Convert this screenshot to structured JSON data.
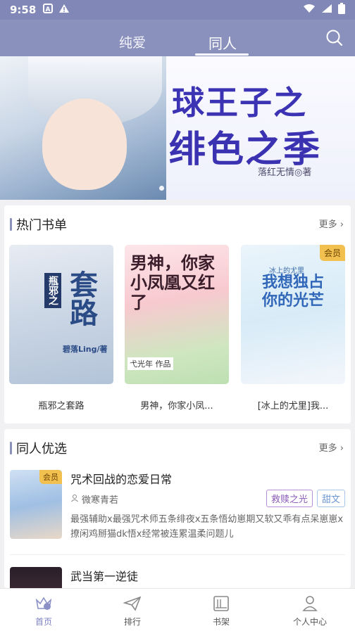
{
  "status": {
    "time": "9:58"
  },
  "header": {
    "tabs": [
      {
        "label": "纯爱"
      },
      {
        "label": "同人"
      }
    ],
    "active_tab": "同人"
  },
  "banner": {
    "title_line1": "球王子之",
    "title_line2": "绯色之季",
    "author": "落红无情◎著"
  },
  "hot": {
    "title": "热门书单",
    "more": "更多",
    "books": [
      {
        "name": "瓶邪之套路",
        "cover_title": "套路",
        "cover_sub": "瓶邪之",
        "cover_author": "碧落Ling/著",
        "badge": ""
      },
      {
        "name": "男神，你家小凤...",
        "cover_title": "男神，你家小凤凰又红了",
        "cover_author": "弋光年 作品",
        "badge": ""
      },
      {
        "name": "[冰上的尤里]我...",
        "cover_title": "我想独占你的光芒",
        "cover_sub": "冰上的尤里",
        "badge": "会员"
      }
    ]
  },
  "picks": {
    "title": "同人优选",
    "more": "更多",
    "items": [
      {
        "title": "咒术回战的恋爱日常",
        "author": "微寒青若",
        "badge": "会员",
        "tags": [
          "救赎之光",
          "甜文"
        ],
        "desc": "最强辅助x最强咒术师五条绯夜x五条悟幼崽期又软又乖有点呆崽崽x撩闲鸡掰猫dk悟x经常被连累温柔问题儿"
      },
      {
        "title": "武当第一逆徒"
      }
    ]
  },
  "bottom_nav": [
    {
      "label": "首页"
    },
    {
      "label": "排行"
    },
    {
      "label": "书架"
    },
    {
      "label": "个人中心"
    }
  ],
  "colors": {
    "header": "#8b91bd",
    "badge": "#f2c04e",
    "active_nav": "#7c80bf"
  }
}
